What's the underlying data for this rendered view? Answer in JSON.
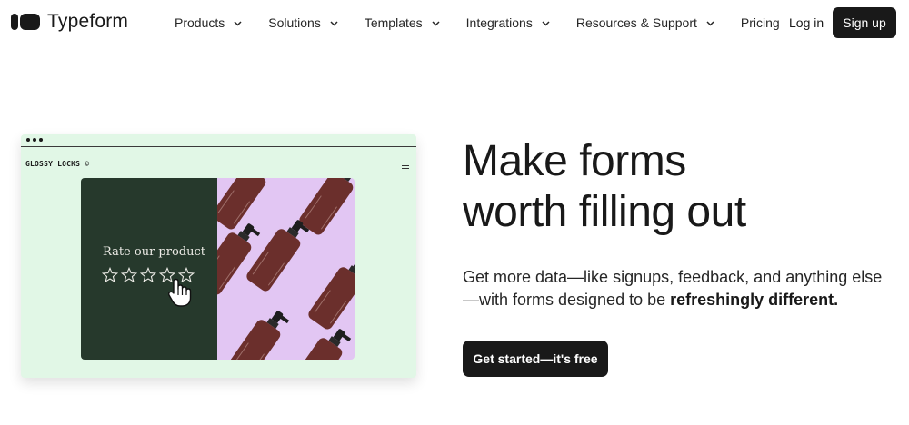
{
  "brand": {
    "name": "Typeform",
    "icon": "typeform-logo-icon"
  },
  "nav": {
    "items": [
      {
        "label": "Products",
        "has_dropdown": true
      },
      {
        "label": "Solutions",
        "has_dropdown": true
      },
      {
        "label": "Templates",
        "has_dropdown": true
      },
      {
        "label": "Integrations",
        "has_dropdown": true
      },
      {
        "label": "Resources & Support",
        "has_dropdown": true
      },
      {
        "label": "Pricing",
        "has_dropdown": false
      }
    ],
    "login_label": "Log in",
    "signup_label": "Sign up"
  },
  "hero": {
    "title_line1": "Make forms",
    "title_line2": "worth filling out",
    "subtitle_plain": "Get more data—like signups, feedback, and anything else—with forms designed to be ",
    "subtitle_bold": "refreshingly different.",
    "cta_label": "Get started—it's free"
  },
  "mockup": {
    "brand_name": "GLOSSY LOCKS ©",
    "prompt": "Rate our product",
    "stars_total": 5,
    "colors": {
      "background": "#e1f7e6",
      "card_left": "#26392c",
      "card_right": "#e2c6f3",
      "bottle": "#6b2f2c"
    }
  },
  "colors": {
    "primary": "#191919",
    "text": "#262626",
    "background": "#ffffff"
  }
}
